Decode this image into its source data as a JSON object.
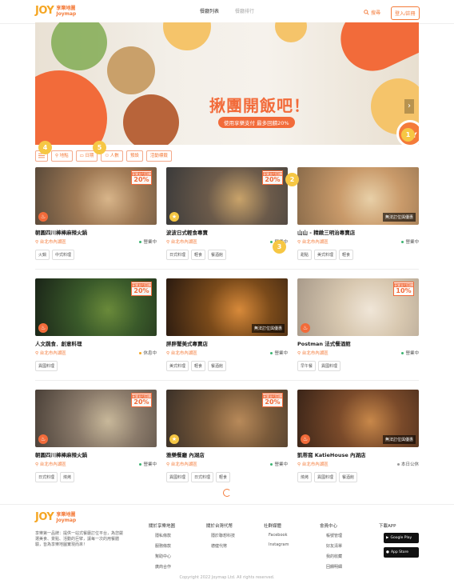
{
  "header": {
    "logo_mark": "JOY",
    "logo_zh": "享樂地圖",
    "logo_en": "Joymap",
    "tabs": [
      {
        "label": "餐廳列表",
        "active": true
      },
      {
        "label": "餐廳排行",
        "active": false
      }
    ],
    "search_label": "搜尋",
    "login_label": "登入/註冊"
  },
  "banner": {
    "title": "揪團開飯吧！",
    "subtitle": "使用享樂支付 最多回饋20%",
    "joy_badge": "JOY",
    "slides_total": 5,
    "slide_active": 1,
    "accent": "#f26b3a"
  },
  "filters": [
    {
      "label": "",
      "icon": "filter-icon"
    },
    {
      "label": "地點",
      "icon": "pin-icon"
    },
    {
      "label": "日期",
      "icon": "calendar-icon"
    },
    {
      "label": "人數",
      "icon": "people-icon"
    },
    {
      "label": "預設",
      "icon": ""
    },
    {
      "label": "活動標籤",
      "icon": ""
    }
  ],
  "markers": [
    "1",
    "2",
    "3",
    "4",
    "5"
  ],
  "restaurants": [
    {
      "name": "朝圓四川棒棒麻辣火鍋",
      "location": "台北市內湖區",
      "status": "營業中",
      "status_color": "#3cb371",
      "tags": [
        "火鍋",
        "中式料理"
      ],
      "promo": "20%",
      "promo_small": "享樂支付回饋",
      "badge": "fire",
      "na": ""
    },
    {
      "name": "波波日式輕食專賣",
      "location": "台北市內湖區",
      "status": "營業中",
      "status_color": "#3cb371",
      "tags": [
        "日式料理",
        "輕食",
        "餐酒館"
      ],
      "promo": "20%",
      "promo_small": "享樂支付回饋",
      "badge": "star",
      "na": ""
    },
    {
      "name": "山山 - 精緻三明治專賣店",
      "location": "台北市內湖區",
      "status": "營業中",
      "status_color": "#3cb371",
      "tags": [
        "甜點",
        "美式料理",
        "輕食"
      ],
      "promo": "",
      "promo_small": "",
      "badge": "",
      "na": "無法訂位與優惠"
    },
    {
      "name": "人文蔬食．創意料理",
      "location": "台北市內湖區",
      "status": "休息中",
      "status_color": "#f5a623",
      "tags": [
        "異國料理"
      ],
      "promo": "20%",
      "promo_small": "享樂支付回饋",
      "badge": "fire",
      "na": ""
    },
    {
      "name": "胖胖蟹美式專賣店",
      "location": "台北市內湖區",
      "status": "營業中",
      "status_color": "#3cb371",
      "tags": [
        "美式料理",
        "輕食",
        "餐酒館"
      ],
      "promo": "",
      "promo_small": "",
      "badge": "",
      "na": "無法訂位與優惠"
    },
    {
      "name": "Postman 法式餐酒館",
      "location": "台北市內湖區",
      "status": "營業中",
      "status_color": "#3cb371",
      "tags": [
        "早午餐",
        "異國料理"
      ],
      "promo": "10%",
      "promo_small": "享樂支付回饋",
      "badge": "fire",
      "na": ""
    },
    {
      "name": "朝圓四川棒棒麻辣火鍋",
      "location": "台北市內湖區",
      "status": "營業中",
      "status_color": "#3cb371",
      "tags": [
        "日式料理",
        "燒烤"
      ],
      "promo": "20%",
      "promo_small": "享樂支付回饋",
      "badge": "fire",
      "na": ""
    },
    {
      "name": "雅樂餐廳 內湖店",
      "location": "台北市內湖區",
      "status": "營業中",
      "status_color": "#3cb371",
      "tags": [
        "異國料理",
        "日式料理",
        "輕食"
      ],
      "promo": "20%",
      "promo_small": "享樂支付回饋",
      "badge": "star",
      "na": ""
    },
    {
      "name": "凱蒂窩 KatieHouse 內湖店",
      "location": "台北市內湖區",
      "status": "本日公休",
      "status_color": "#999999",
      "tags": [
        "燒烤",
        "異國料理",
        "餐酒館"
      ],
      "promo": "",
      "promo_small": "",
      "badge": "fire",
      "na": "無法訂位與優惠"
    }
  ],
  "footer": {
    "logo_mark": "JOY",
    "logo_zh": "享樂地圖",
    "logo_en": "Joymap",
    "description": "享樂第一品牌：提供一站式餐廳訂位平台，為您嚴選美食、景點、活動的巨擘，讓每一次的用餐體驗，皆為享樂地圖實現而來！",
    "columns": [
      {
        "title": "關於享樂地圖",
        "links": [
          "隱私條款",
          "服務條款",
          "幫助中心",
          "廣商合作"
        ]
      },
      {
        "title": "關於台灣代幣",
        "links": [
          "隱於聯想科技",
          "德健代幣"
        ]
      },
      {
        "title": "社群媒體",
        "links": [
          "Facebook",
          "Instagram"
        ]
      },
      {
        "title": "會員中心",
        "links": [
          "帳號管理",
          "好友清單",
          "我的收藏",
          "回饋明細"
        ]
      },
      {
        "title": "下載APP",
        "links": []
      }
    ],
    "store_buttons": [
      "Google Play",
      "App Store"
    ],
    "copyright": "Copyright 2022 Joymap Ltd. All rights reserved."
  }
}
